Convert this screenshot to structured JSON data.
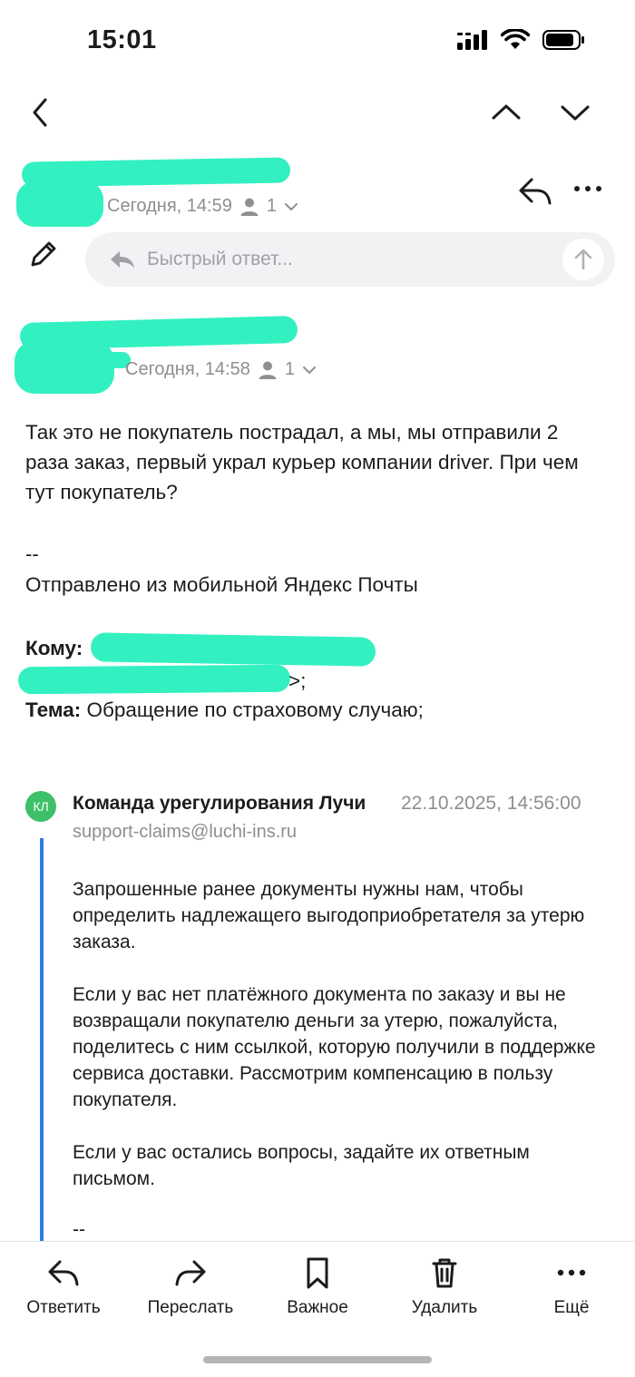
{
  "status_bar": {
    "time": "15:01"
  },
  "thread": {
    "messages": [
      {
        "date": "Сегодня, 14:59",
        "recipients_count": "1"
      },
      {
        "date": "Сегодня, 14:58",
        "recipients_count": "1"
      }
    ],
    "quick_reply_placeholder": "Быстрый ответ...",
    "body": "Так это не покупатель пострадал, а мы, мы отправили 2 раза заказ, первый украл курьер компании driver. При чем тут покупатель?",
    "signature_separator": "--",
    "signature": "Отправлено из мобильной Яндекс Почты",
    "to_label": "Кому:",
    "to_tail": ">;",
    "subject_label": "Тема:",
    "subject_value": "Обращение по страховому случаю;"
  },
  "quoted": {
    "avatar_initials": "КЛ",
    "sender": "Команда урегулирования Лучи",
    "date": "22.10.2025, 14:56:00",
    "email": "support-claims@luchi-ins.ru",
    "paragraphs": [
      "Запрошенные ранее документы нужны нам, чтобы определить надлежащего выгодоприобретателя за утерю заказа.",
      "Если у вас нет платёжного документа по заказу и вы не возвращали покупателю деньги за утерю, пожалуйста, поделитесь с ним ссылкой, которую получили в поддержке сервиса доставки. Рассмотрим компенсацию в пользу покупателя.",
      "Если у вас остались вопросы, задайте их ответным письмом."
    ],
    "separator": "--"
  },
  "toolbar": {
    "reply": "Ответить",
    "forward": "Переслать",
    "important": "Важное",
    "delete": "Удалить",
    "more": "Ещё"
  }
}
